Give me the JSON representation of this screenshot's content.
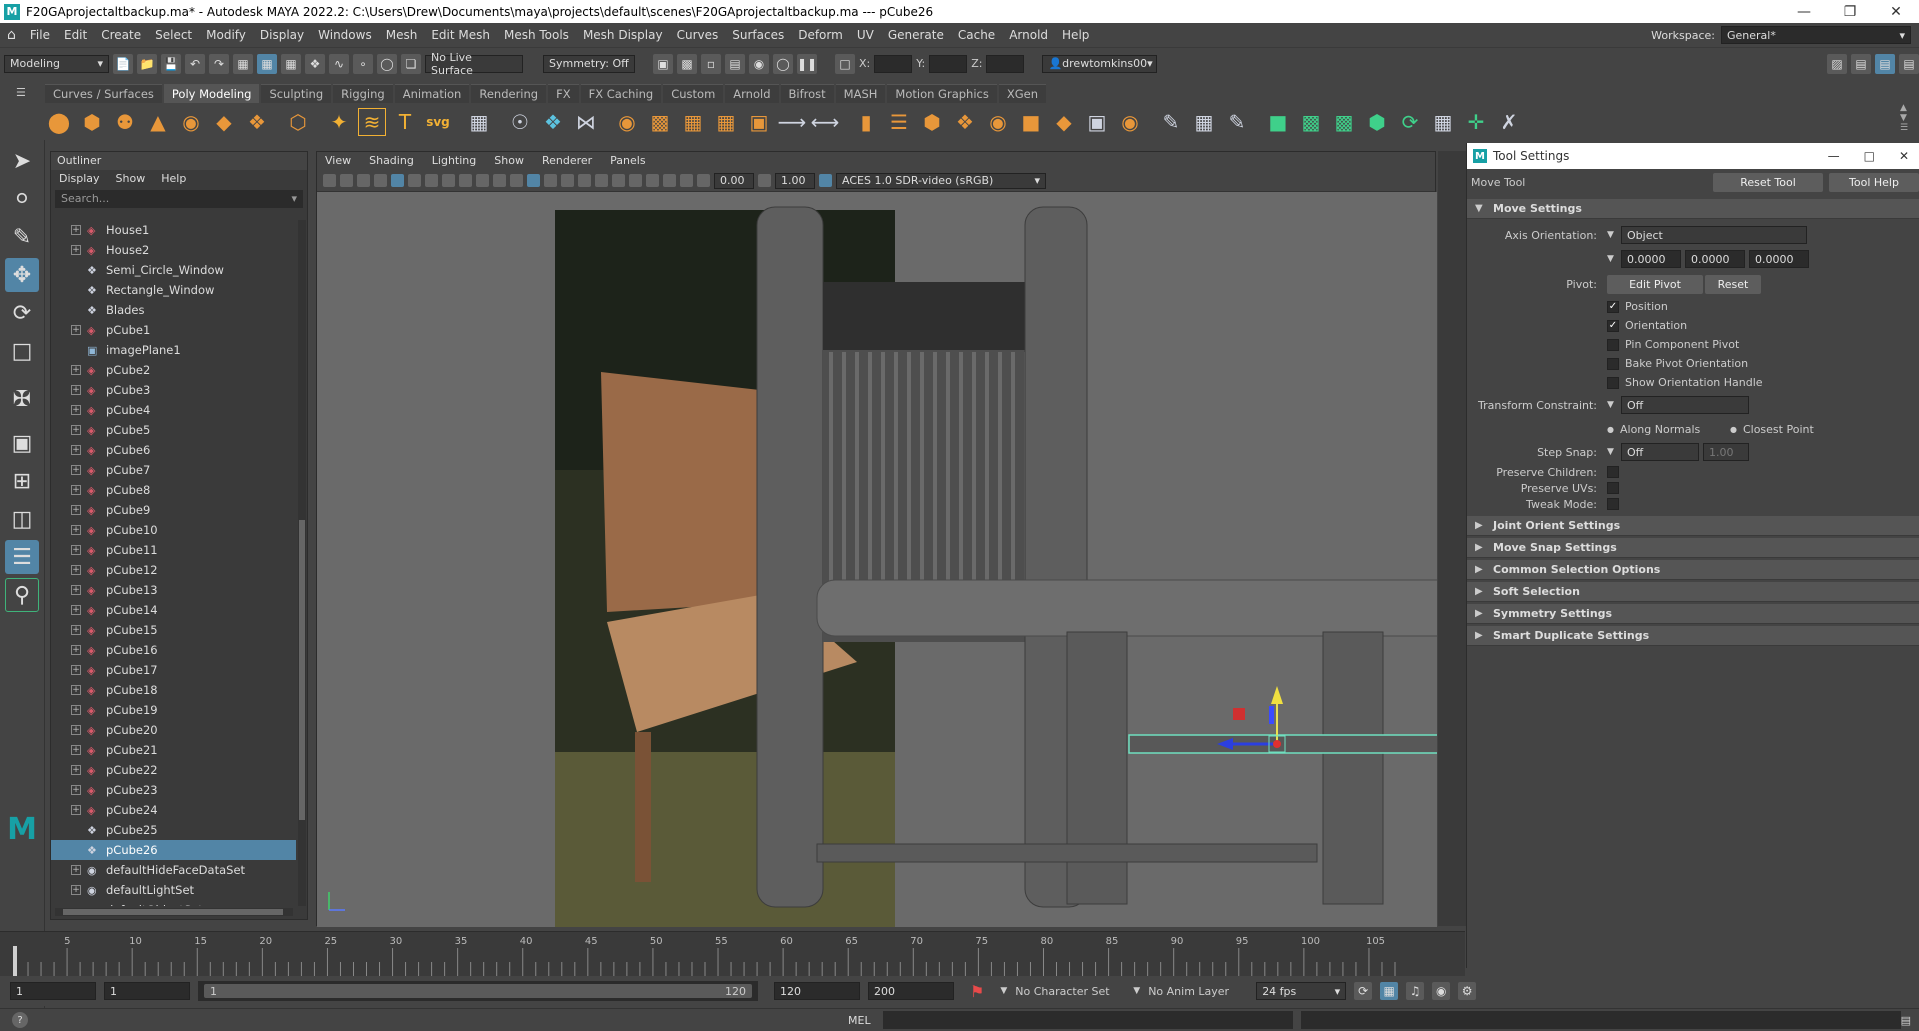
{
  "window": {
    "title": "F20GAprojectaltbackup.ma* - Autodesk MAYA 2022.2: C:\\Users\\Drew\\Documents\\maya\\projects\\default\\scenes\\F20GAprojectaltbackup.ma  ---  pCube26"
  },
  "menubar": {
    "items": [
      "File",
      "Edit",
      "Create",
      "Select",
      "Modify",
      "Display",
      "Windows",
      "Mesh",
      "Edit Mesh",
      "Mesh Tools",
      "Mesh Display",
      "Curves",
      "Surfaces",
      "Deform",
      "UV",
      "Generate",
      "Cache",
      "Arnold",
      "Help"
    ],
    "workspace_label": "Workspace:",
    "workspace_value": "General*"
  },
  "statusline": {
    "mode": "Modeling",
    "live_surface": "No Live Surface",
    "symmetry": "Symmetry: Off",
    "x_label": "X:",
    "y_label": "Y:",
    "z_label": "Z:",
    "user": "drewtomkins00"
  },
  "shelf": {
    "tabs": [
      "Curves / Surfaces",
      "Poly Modeling",
      "Sculpting",
      "Rigging",
      "Animation",
      "Rendering",
      "FX",
      "FX Caching",
      "Custom",
      "Arnold",
      "Bifrost",
      "MASH",
      "Motion Graphics",
      "XGen"
    ],
    "active_tab": "Poly Modeling"
  },
  "outliner": {
    "title": "Outliner",
    "menu": [
      "Display",
      "Show",
      "Help"
    ],
    "search_placeholder": "Search...",
    "items": [
      {
        "label": "House1",
        "expand": true,
        "icon": "transform"
      },
      {
        "label": "House2",
        "expand": true,
        "icon": "transform"
      },
      {
        "label": "Semi_Circle_Window",
        "expand": false,
        "icon": "group"
      },
      {
        "label": "Rectangle_Window",
        "expand": false,
        "icon": "group"
      },
      {
        "label": "Blades",
        "expand": false,
        "icon": "group"
      },
      {
        "label": "pCube1",
        "expand": true,
        "icon": "transform"
      },
      {
        "label": "imagePlane1",
        "expand": false,
        "icon": "image"
      },
      {
        "label": "pCube2",
        "expand": true,
        "icon": "transform"
      },
      {
        "label": "pCube3",
        "expand": true,
        "icon": "transform"
      },
      {
        "label": "pCube4",
        "expand": true,
        "icon": "transform"
      },
      {
        "label": "pCube5",
        "expand": true,
        "icon": "transform"
      },
      {
        "label": "pCube6",
        "expand": true,
        "icon": "transform"
      },
      {
        "label": "pCube7",
        "expand": true,
        "icon": "transform"
      },
      {
        "label": "pCube8",
        "expand": true,
        "icon": "transform"
      },
      {
        "label": "pCube9",
        "expand": true,
        "icon": "transform"
      },
      {
        "label": "pCube10",
        "expand": true,
        "icon": "transform"
      },
      {
        "label": "pCube11",
        "expand": true,
        "icon": "transform"
      },
      {
        "label": "pCube12",
        "expand": true,
        "icon": "transform"
      },
      {
        "label": "pCube13",
        "expand": true,
        "icon": "transform"
      },
      {
        "label": "pCube14",
        "expand": true,
        "icon": "transform"
      },
      {
        "label": "pCube15",
        "expand": true,
        "icon": "transform"
      },
      {
        "label": "pCube16",
        "expand": true,
        "icon": "transform"
      },
      {
        "label": "pCube17",
        "expand": true,
        "icon": "transform"
      },
      {
        "label": "pCube18",
        "expand": true,
        "icon": "transform"
      },
      {
        "label": "pCube19",
        "expand": true,
        "icon": "transform"
      },
      {
        "label": "pCube20",
        "expand": true,
        "icon": "transform"
      },
      {
        "label": "pCube21",
        "expand": true,
        "icon": "transform"
      },
      {
        "label": "pCube22",
        "expand": true,
        "icon": "transform"
      },
      {
        "label": "pCube23",
        "expand": true,
        "icon": "transform"
      },
      {
        "label": "pCube24",
        "expand": true,
        "icon": "transform"
      },
      {
        "label": "pCube25",
        "expand": false,
        "icon": "group"
      },
      {
        "label": "pCube26",
        "expand": false,
        "icon": "group",
        "selected": true
      },
      {
        "label": "defaultHideFaceDataSet",
        "expand": true,
        "icon": "set"
      },
      {
        "label": "defaultLightSet",
        "expand": true,
        "icon": "set"
      },
      {
        "label": "defaultObjectSet",
        "expand": false,
        "icon": "set"
      }
    ]
  },
  "viewport": {
    "menu": [
      "View",
      "Shading",
      "Lighting",
      "Show",
      "Renderer",
      "Panels"
    ],
    "exposure": "0.00",
    "gamma": "1.00",
    "color_space": "ACES 1.0 SDR-video (sRGB)"
  },
  "timeline": {
    "ticks": [
      "5",
      "10",
      "15",
      "20",
      "25",
      "30",
      "35",
      "40",
      "45",
      "50",
      "55",
      "60",
      "65",
      "70",
      "75",
      "80",
      "85",
      "90",
      "95",
      "100",
      "105"
    ]
  },
  "range": {
    "start": "1",
    "current": "1",
    "slider_start": "1",
    "slider_end": "120",
    "end": "120",
    "anim_end": "200",
    "char_set": "No Character Set",
    "anim_layer": "No Anim Layer",
    "fps": "24 fps"
  },
  "cmdline": {
    "lang": "MEL"
  },
  "tool_settings": {
    "window_title": "Tool Settings",
    "tool_name": "Move Tool",
    "reset_tool": "Reset Tool",
    "tool_help": "Tool Help",
    "move_settings": "Move Settings",
    "axis_orientation_label": "Axis Orientation:",
    "axis_orientation_value": "Object",
    "v1": "0.0000",
    "v2": "0.0000",
    "v3": "0.0000",
    "pivot_label": "Pivot:",
    "edit_pivot": "Edit Pivot",
    "reset": "Reset",
    "checks": [
      {
        "label": "Position",
        "checked": true
      },
      {
        "label": "Orientation",
        "checked": true
      },
      {
        "label": "Pin Component Pivot",
        "checked": false
      },
      {
        "label": "Bake Pivot Orientation",
        "checked": false
      },
      {
        "label": "Show Orientation Handle",
        "checked": false
      }
    ],
    "transform_constraint_label": "Transform Constraint:",
    "transform_constraint_value": "Off",
    "along_normals": "Along Normals",
    "closest_point": "Closest Point",
    "step_snap_label": "Step Snap:",
    "step_snap_value": "Off",
    "step_snap_amount": "1.00",
    "preserve_children": "Preserve Children:",
    "preserve_uvs": "Preserve UVs:",
    "tweak_mode": "Tweak Mode:",
    "sections": [
      "Joint Orient Settings",
      "Move Snap Settings",
      "Common Selection Options",
      "Soft Selection",
      "Symmetry Settings",
      "Smart Duplicate Settings"
    ]
  },
  "colors": {
    "selection": "#5285a6",
    "panel": "#444444",
    "scene_bg": "#6a6a6a"
  }
}
